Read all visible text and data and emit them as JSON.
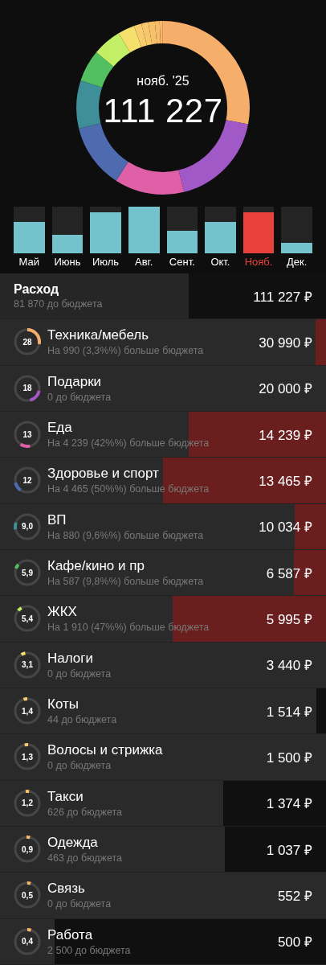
{
  "summary": {
    "period": "нояб. '25",
    "total": "111 227"
  },
  "months": [
    {
      "label": "Май",
      "level": 0.67,
      "selected": false
    },
    {
      "label": "Июнь",
      "level": 0.4,
      "selected": false
    },
    {
      "label": "Июль",
      "level": 0.88,
      "selected": false
    },
    {
      "label": "Авг.",
      "level": 1.0,
      "selected": false
    },
    {
      "label": "Сент.",
      "level": 0.48,
      "selected": false
    },
    {
      "label": "Окт.",
      "level": 0.67,
      "selected": false
    },
    {
      "label": "Нояб.",
      "level": 0.88,
      "selected": true
    },
    {
      "label": "Дек.",
      "level": 0.22,
      "selected": false
    }
  ],
  "total_row": {
    "title": "Расход",
    "subtitle": "81 870 до бюджета",
    "amount": "111 227 ₽",
    "budget_bar": {
      "over_budget": false,
      "level": 0.42
    }
  },
  "categories": [
    {
      "share": "28",
      "level": 0.28,
      "color": "#f6ae6b",
      "title": "Техника/мебель",
      "subtitle": "На 990 (3,3%%) больше бюджета",
      "amount": "30 990 ₽",
      "budget_bar": {
        "over_budget": true,
        "level": 0.032
      }
    },
    {
      "share": "18",
      "level": 0.18,
      "color": "#a259c8",
      "title": "Подарки",
      "subtitle": "0 до бюджета",
      "amount": "20 000 ₽"
    },
    {
      "share": "13",
      "level": 0.13,
      "color": "#e060a8",
      "title": "Еда",
      "subtitle": "На 4 239 (42%%) больше бюджета",
      "amount": "14 239 ₽",
      "budget_bar": {
        "over_budget": true,
        "level": 0.42
      }
    },
    {
      "share": "12",
      "level": 0.12,
      "color": "#4e6bb0",
      "title": "Здоровье и спорт",
      "subtitle": "На 4 465 (50%%) больше бюджета",
      "amount": "13 465 ₽",
      "budget_bar": {
        "over_budget": true,
        "level": 0.5
      }
    },
    {
      "share": "9,0",
      "level": 0.09,
      "color": "#3e8f98",
      "title": "ВП",
      "subtitle": "На 880 (9,6%%) больше бюджета",
      "amount": "10 034 ₽",
      "budget_bar": {
        "over_budget": true,
        "level": 0.096
      }
    },
    {
      "share": "5,9",
      "level": 0.059,
      "color": "#52c060",
      "title": "Кафе/кино и пр",
      "subtitle": "На 587 (9,8%%) больше бюджета",
      "amount": "6 587 ₽",
      "budget_bar": {
        "over_budget": true,
        "level": 0.098
      }
    },
    {
      "share": "5,4",
      "level": 0.054,
      "color": "#c2ef66",
      "title": "ЖКХ",
      "subtitle": "На 1 910 (47%%) больше бюджета",
      "amount": "5 995 ₽",
      "budget_bar": {
        "over_budget": true,
        "level": 0.47
      }
    },
    {
      "share": "3,1",
      "level": 0.031,
      "color": "#f5e06e",
      "title": "Налоги",
      "subtitle": "0 до бюджета",
      "amount": "3 440 ₽"
    },
    {
      "share": "1,4",
      "level": 0.014,
      "color": "#f9cd6e",
      "title": "Коты",
      "subtitle": "44 до бюджета",
      "amount": "1 514 ₽",
      "budget_bar": {
        "over_budget": false,
        "level": 0.03
      }
    },
    {
      "share": "1,3",
      "level": 0.013,
      "color": "#f8c76c",
      "title": "Волосы и стрижка",
      "subtitle": "0 до бюджета",
      "amount": "1 500 ₽"
    },
    {
      "share": "1,2",
      "level": 0.012,
      "color": "#f7c16a",
      "title": "Такси",
      "subtitle": "626 до бюджета",
      "amount": "1 374 ₽",
      "budget_bar": {
        "over_budget": false,
        "level": 0.315
      }
    },
    {
      "share": "0,9",
      "level": 0.009,
      "color": "#f7bb69",
      "title": "Одежда",
      "subtitle": "463 до бюджета",
      "amount": "1 037 ₽",
      "budget_bar": {
        "over_budget": false,
        "level": 0.31
      }
    },
    {
      "share": "0,5",
      "level": 0.005,
      "color": "#f7b668",
      "title": "Связь",
      "subtitle": "0 до бюджета",
      "amount": "552 ₽"
    },
    {
      "share": "0,4",
      "level": 0.004,
      "color": "#f6b268",
      "title": "Работа",
      "subtitle": "2 500 до бюджета",
      "amount": "500 ₽",
      "budget_bar": {
        "over_budget": false,
        "level": 0.833
      }
    }
  ]
}
